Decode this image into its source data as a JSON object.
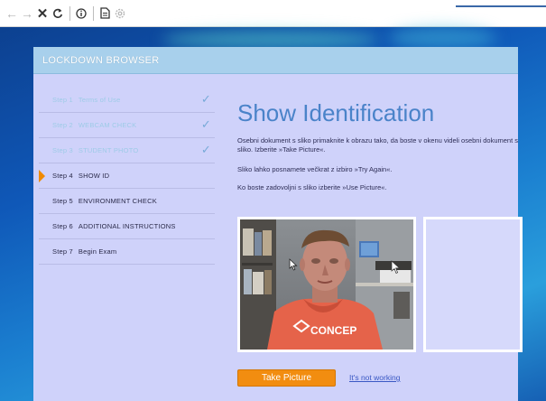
{
  "browser": {
    "back_icon": "arrow-left-icon",
    "forward_icon": "arrow-right-icon",
    "stop_icon": "close-icon",
    "reload_icon": "reload-icon",
    "info_icon": "info-icon",
    "page_icon": "page-icon",
    "settings_icon": "gear-icon"
  },
  "app": {
    "title": "LOCKDOWN BROWSER"
  },
  "sidebar": {
    "steps": [
      {
        "num": "Step 1",
        "label": "Terms of Use",
        "state": "done"
      },
      {
        "num": "Step 2",
        "label": "WEBCAM CHECK",
        "state": "done"
      },
      {
        "num": "Step 3",
        "label": "STUDENT PHOTO",
        "state": "done"
      },
      {
        "num": "Step 4",
        "label": "SHOW ID",
        "state": "current"
      },
      {
        "num": "Step 5",
        "label": "ENVIRONMENT CHECK",
        "state": "pending"
      },
      {
        "num": "Step 6",
        "label": "ADDITIONAL INSTRUCTIONS",
        "state": "pending"
      },
      {
        "num": "Step 7",
        "label": "Begin Exam",
        "state": "pending"
      }
    ]
  },
  "main": {
    "heading": "Show Identification",
    "paragraph1": "Osebni dokument s sliko primaknite k obrazu tako, da boste v okenu videli osebni dokument s sliko. Izberite »Take Picture«.",
    "paragraph2": "Sliko lahko posnamete večkrat z izbiro »Try Again«.",
    "paragraph3": "Ko boste zadovoljni s sliko izberite »Use Picture«.",
    "shirt_text": "CONCEP",
    "take_picture_label": "Take Picture",
    "not_working_label": "It's not working"
  },
  "colors": {
    "accent_orange": "#f28d10",
    "heading_blue": "#4a83c9",
    "panel_lavender": "#cfd2fa",
    "header_bar": "#a8d0ec"
  }
}
